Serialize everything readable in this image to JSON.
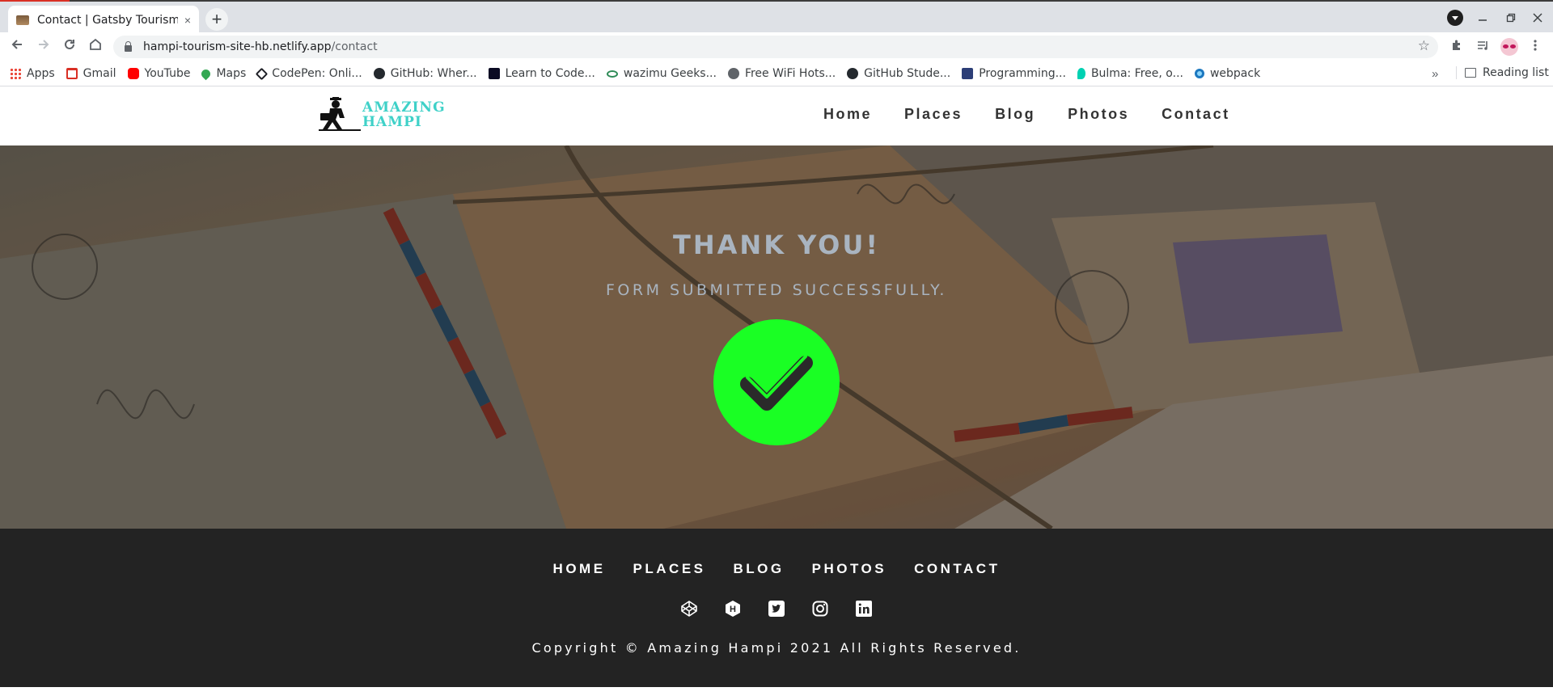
{
  "browser": {
    "tab_title": "Contact | Gatsby Tourism",
    "tab_close": "×",
    "new_tab": "+",
    "url_host": "hampi-tourism-site-hb.netlify.app",
    "url_path": "/contact",
    "bookmarks": [
      {
        "label": "Apps",
        "color": "#ea4335"
      },
      {
        "label": "Gmail",
        "color": "#d93025"
      },
      {
        "label": "YouTube",
        "color": "#ff0000"
      },
      {
        "label": "Maps",
        "color": "#34a853"
      },
      {
        "label": "CodePen: Onli...",
        "color": "#1e1f26"
      },
      {
        "label": "GitHub: Wher...",
        "color": "#24292e"
      },
      {
        "label": "Learn to Code...",
        "color": "#0a0a23"
      },
      {
        "label": "wazimu Geeks...",
        "color": "#2e8b57"
      },
      {
        "label": "Free WiFi Hots...",
        "color": "#5f6368"
      },
      {
        "label": "GitHub Stude...",
        "color": "#24292e"
      },
      {
        "label": "Programming...",
        "color": "#2c3e77"
      },
      {
        "label": "Bulma: Free, o...",
        "color": "#00d1b2"
      },
      {
        "label": "webpack",
        "color": "#1c78c0"
      }
    ],
    "bookmarks_more": "»",
    "reading_list": "Reading list"
  },
  "site": {
    "logo_line1": "AMAZING",
    "logo_line2": "HAMPI",
    "nav": [
      "Home",
      "Places",
      "Blog",
      "Photos",
      "Contact"
    ]
  },
  "hero": {
    "title": "THANK YOU!",
    "subtitle": "FORM SUBMITTED SUCCESSFULLY.",
    "check_color": "#1aff24"
  },
  "footer": {
    "nav": [
      "HOME",
      "PLACES",
      "BLOG",
      "PHOTOS",
      "CONTACT"
    ],
    "social_icons": [
      "codepen-icon",
      "hashnode-icon",
      "twitter-icon",
      "instagram-icon",
      "linkedin-icon"
    ],
    "copyright": "Copyright © Amazing Hampi 2021 All Rights Reserved."
  }
}
